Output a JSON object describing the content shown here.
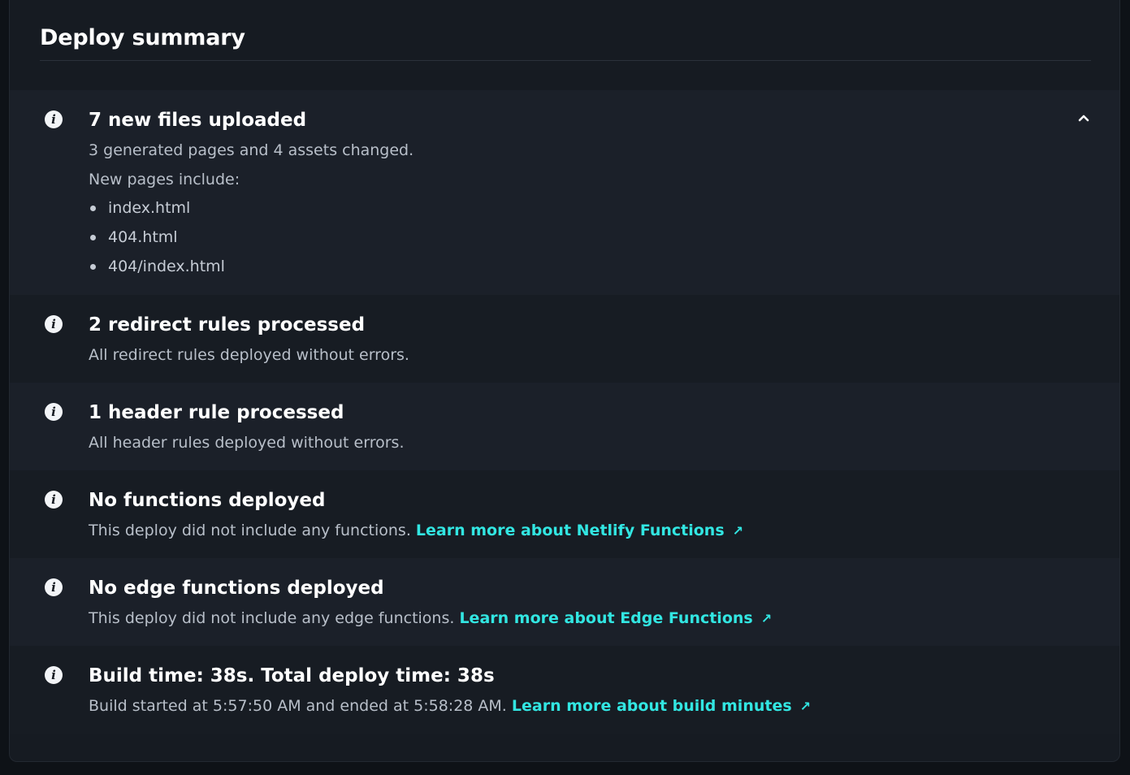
{
  "summary": {
    "title": "Deploy summary",
    "accent_color": "#32e6e2",
    "items": [
      {
        "icon": "info-icon",
        "title": "7 new files uploaded",
        "description": "3 generated pages and 4 assets changed.",
        "subheading": "New pages include:",
        "pages": [
          "index.html",
          "404.html",
          "404/index.html"
        ],
        "expanded": true,
        "toggle_icon": "chevron-up-icon"
      },
      {
        "icon": "info-icon",
        "title": "2 redirect rules processed",
        "description": "All redirect rules deployed without errors."
      },
      {
        "icon": "info-icon",
        "title": "1 header rule processed",
        "description": "All header rules deployed without errors."
      },
      {
        "icon": "info-icon",
        "title": "No functions deployed",
        "description": "This deploy did not include any functions.",
        "link_label": "Learn more about Netlify Functions",
        "link_icon": "external-link-icon",
        "link_glyph": "↗"
      },
      {
        "icon": "info-icon",
        "title": "No edge functions deployed",
        "description": "This deploy did not include any edge functions.",
        "link_label": "Learn more about Edge Functions",
        "link_icon": "external-link-icon",
        "link_glyph": "↗"
      },
      {
        "icon": "info-icon",
        "title": "Build time: 38s. Total deploy time: 38s",
        "description": "Build started at 5:57:50 AM and ended at 5:58:28 AM.",
        "link_label": "Learn more about build minutes",
        "link_icon": "external-link-icon",
        "link_glyph": "↗"
      }
    ]
  }
}
